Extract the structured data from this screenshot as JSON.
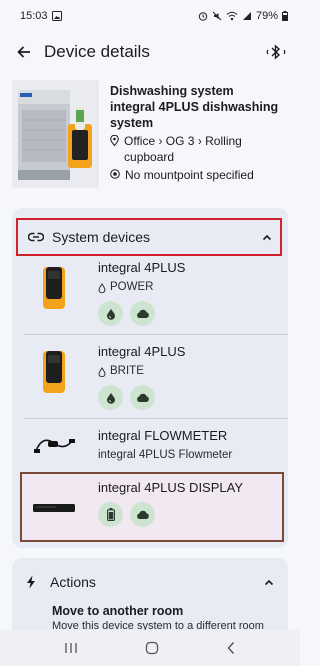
{
  "status_bar": {
    "time": "15:03",
    "battery": "79%"
  },
  "app_bar": {
    "title": "Device details"
  },
  "header": {
    "name": "Dishwashing system",
    "model": "integral 4PLUS dishwashing system",
    "location": "Office › OG 3 › Rolling cupboard",
    "mountpoint": "No mountpoint specified"
  },
  "system_devices": {
    "title": "System devices",
    "devices": [
      {
        "name": "integral 4PLUS",
        "subtitle": "POWER",
        "chips": [
          "drop-icon",
          "cloud-icon"
        ]
      },
      {
        "name": "integral 4PLUS",
        "subtitle": "BRITE",
        "chips": [
          "drop-icon",
          "cloud-icon"
        ]
      },
      {
        "name": "integral FLOWMETER",
        "subtitle": "integral 4PLUS Flowmeter",
        "chips": []
      },
      {
        "name": "integral 4PLUS DISPLAY",
        "subtitle": "",
        "chips": [
          "battery-icon",
          "cloud-icon"
        ]
      }
    ]
  },
  "actions": {
    "title": "Actions",
    "move_title": "Move to another room",
    "move_desc": "Move this device system to a different room"
  },
  "colors": {
    "accent_red": "#d1222a",
    "chip_green": "#cde4d1",
    "section_bg": "#e8ebf3",
    "selection_border": "#7b4a3a"
  }
}
